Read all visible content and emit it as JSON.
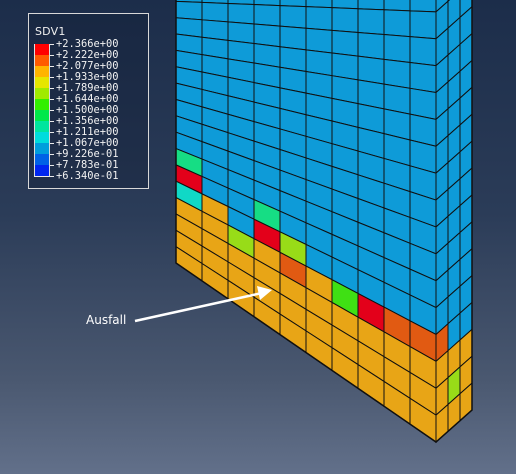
{
  "legend": {
    "title": "SDV1",
    "entries": [
      {
        "value": "+2.366e+00",
        "color": "#ff0000"
      },
      {
        "value": "+2.222e+00",
        "color": "#ff5a00"
      },
      {
        "value": "+2.077e+00",
        "color": "#ffb400"
      },
      {
        "value": "+1.933e+00",
        "color": "#e6e600"
      },
      {
        "value": "+1.789e+00",
        "color": "#a0ea00"
      },
      {
        "value": "+1.644e+00",
        "color": "#33ef00"
      },
      {
        "value": "+1.500e+00",
        "color": "#00e84a"
      },
      {
        "value": "+1.356e+00",
        "color": "#00e59e"
      },
      {
        "value": "+1.211e+00",
        "color": "#00dcdc"
      },
      {
        "value": "+1.067e+00",
        "color": "#009edc"
      },
      {
        "value": "+9.226e-01",
        "color": "#0062e6"
      },
      {
        "value": "+7.783e-01",
        "color": "#0026f0"
      },
      {
        "value": "+6.340e-01",
        "color": ""
      }
    ]
  },
  "annotation": {
    "label": "Ausfall"
  },
  "colors": {
    "blue_element": "#0e9bd8",
    "orange_element": "#e8a516",
    "red_element": "#e3001a",
    "dark_orange_element": "#e15a12",
    "green_element": "#3fe014",
    "yellow_green_element": "#98dc18",
    "mint_element": "#16dd84",
    "cyan_element": "#10d8c6",
    "mesh_line": "#101010"
  }
}
